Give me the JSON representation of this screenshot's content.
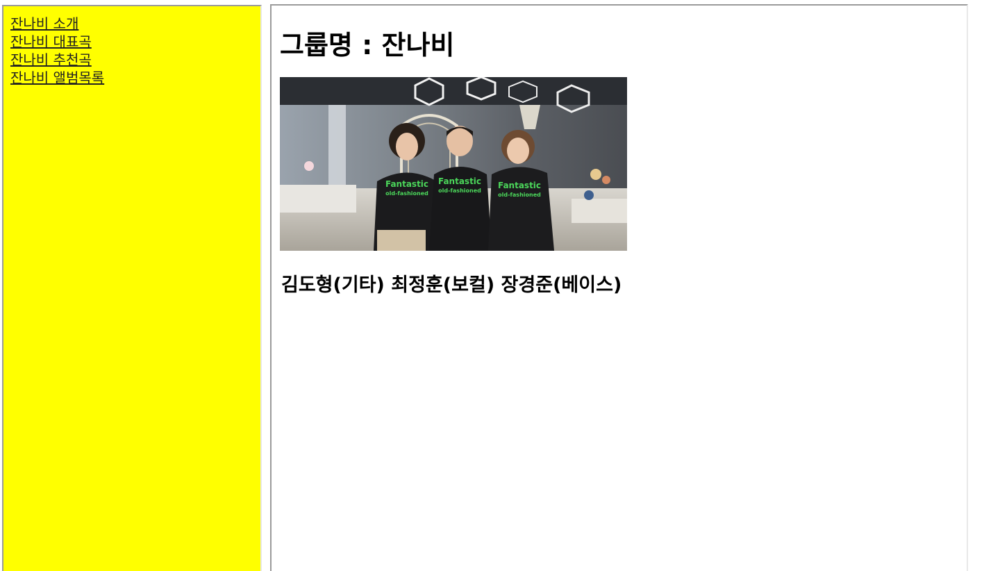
{
  "nav": {
    "items": [
      {
        "label": "잔나비 소개"
      },
      {
        "label": "잔나비 대표곡"
      },
      {
        "label": "잔나비 추천곡"
      },
      {
        "label": "잔나비 앨범목록"
      }
    ]
  },
  "main": {
    "title": "그룹명 : 잔나비",
    "photo": {
      "shirt_text_line1": "Fantastic",
      "shirt_text_line2": "old-fashioned"
    },
    "members": "김도형(기타) 최정훈(보컬) 장경준(베이스)"
  },
  "colors": {
    "nav_background": "#ffff00",
    "link": "#222222",
    "shirt_print": "#4bd65a"
  }
}
